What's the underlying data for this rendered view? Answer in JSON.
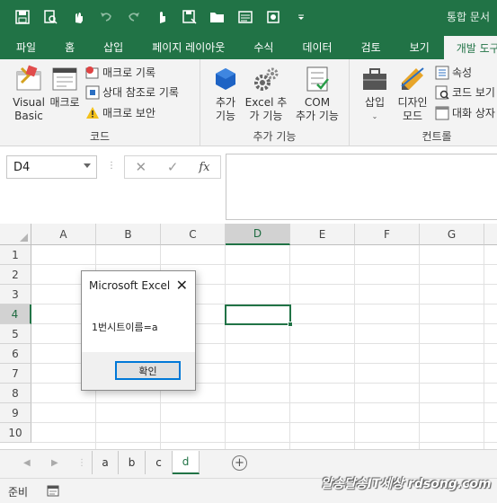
{
  "window": {
    "title": "통합 문서"
  },
  "quick_access": {
    "icons": [
      "save-icon",
      "print-preview-icon",
      "touch-mode-icon",
      "undo-icon",
      "redo-icon",
      "hand-icon",
      "save-as-icon",
      "open-folder-icon",
      "form-icon",
      "macro-icon",
      "customize-icon"
    ]
  },
  "ribbon_tabs": [
    "파일",
    "홈",
    "삽입",
    "페이지 레이아웃",
    "수식",
    "데이터",
    "검토",
    "보기",
    "개발 도구"
  ],
  "active_tab": "개발 도구",
  "ribbon": {
    "code_group": {
      "label": "코드",
      "visual_basic": "Visual Basic",
      "macro": "매크로",
      "record_macro": "매크로 기록",
      "relative_refs": "상대 참조로 기록",
      "macro_security": "매크로 보안"
    },
    "addins_group": {
      "label": "추가 기능",
      "addins_line1": "추가",
      "addins_line2": "기능",
      "excel_addins_line1": "Excel 추",
      "excel_addins_line2": "가 기능",
      "com_addins_line1": "COM",
      "com_addins_line2": "추가 기능"
    },
    "controls_group": {
      "label": "컨트롤",
      "insert": "삽입",
      "design_mode_line1": "디자인",
      "design_mode_line2": "모드",
      "properties": "속성",
      "view_code": "코드 보기",
      "run_dialog": "대화 상자 실행"
    }
  },
  "formula_bar": {
    "name_box": "D4",
    "cancel_symbol": "✕",
    "enter_symbol": "✓",
    "fx_symbol": "fx",
    "value": ""
  },
  "grid": {
    "columns": [
      "A",
      "B",
      "C",
      "D",
      "E",
      "F",
      "G"
    ],
    "rows": [
      "1",
      "2",
      "3",
      "4",
      "5",
      "6",
      "7",
      "8",
      "9",
      "10"
    ],
    "selected_cell": "D4"
  },
  "dialog": {
    "title": "Microsoft Excel",
    "message": "1번시트이름=a",
    "ok_button": "확인",
    "close_symbol": "✕"
  },
  "sheets": [
    "a",
    "b",
    "c",
    "d"
  ],
  "active_sheet": "d",
  "sheet_add_symbol": "+",
  "status": {
    "ready": "준비"
  },
  "watermark": "알송달송IT세상 rdsong.com",
  "colors": {
    "excel_green": "#217346",
    "ribbon_bg": "#f3f3f3",
    "dialog_button_border": "#0078d7"
  }
}
